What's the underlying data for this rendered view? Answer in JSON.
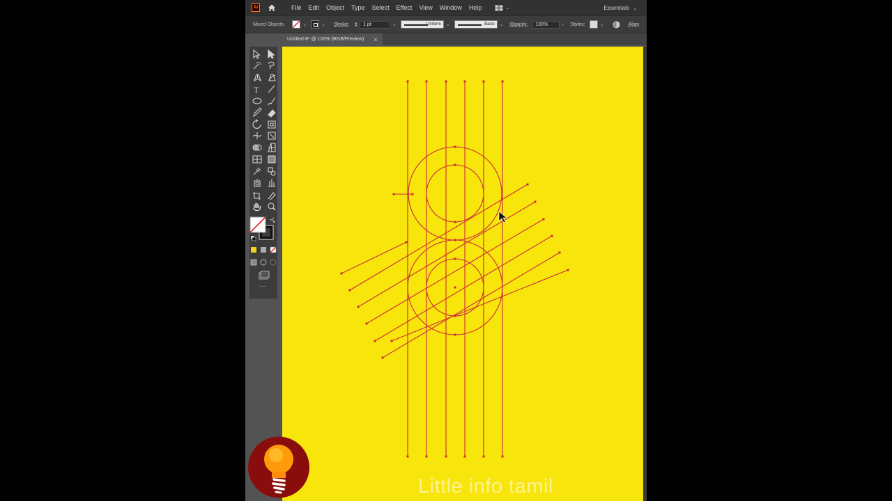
{
  "app": {
    "logo_text": "Ai"
  },
  "menu": {
    "items": [
      "File",
      "Edit",
      "Object",
      "Type",
      "Select",
      "Effect",
      "View",
      "Window",
      "Help"
    ],
    "workspace": "Essentials"
  },
  "control_bar": {
    "selection_label": "Mixed Objects",
    "stroke_label": "Stroke:",
    "stroke_weight": "1 pt",
    "variable_width": "Uniform",
    "brush": "Basic",
    "opacity_label": "Opacity:",
    "opacity_value": "100%",
    "styles_label": "Styles:",
    "align_label": "Align"
  },
  "document": {
    "tab_title": "Untitled-8* @ 100% (RGB/Preview)",
    "close_symbol": "×"
  },
  "toolbar": {
    "more_symbol": "···"
  },
  "canvas": {
    "background": "#f8e50c",
    "path_color": "#cc2a3a",
    "watermark": "Little info tamil"
  },
  "colors": {
    "ui_dark": "#323232",
    "panel": "#535353",
    "accent": "#ff7c00"
  },
  "icons": [
    "home-icon",
    "selection-tool-icon",
    "direct-selection-tool-icon",
    "magic-wand-icon",
    "lasso-icon",
    "pen-tool-icon",
    "curvature-tool-icon",
    "type-tool-icon",
    "line-tool-icon",
    "ellipse-tool-icon",
    "paintbrush-icon",
    "pencil-icon",
    "eraser-icon",
    "rotate-tool-icon",
    "scale-tool-icon",
    "width-tool-icon",
    "free-transform-icon",
    "shape-builder-icon",
    "perspective-grid-icon",
    "mesh-tool-icon",
    "gradient-tool-icon",
    "eyedropper-icon",
    "blend-tool-icon",
    "symbol-sprayer-icon",
    "column-graph-icon",
    "artboard-tool-icon",
    "slice-tool-icon",
    "hand-tool-icon",
    "zoom-tool-icon",
    "fill-stroke-icon",
    "swap-colors-icon",
    "default-colors-icon",
    "color-mode-icons",
    "draw-mode-icons",
    "screen-mode-icon",
    "lightbulb-logo-icon"
  ]
}
